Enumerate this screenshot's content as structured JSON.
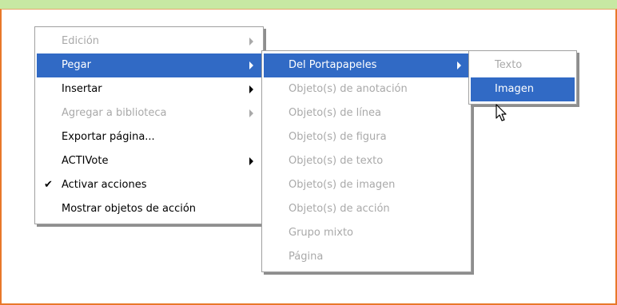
{
  "context_menu": {
    "items": [
      {
        "label": "Edición"
      },
      {
        "label": "Pegar"
      },
      {
        "label": "Insertar"
      },
      {
        "label": "Agregar a biblioteca"
      },
      {
        "label": "Exportar página..."
      },
      {
        "label": "ACTIVote"
      },
      {
        "label": "Activar acciones",
        "checkmark": "✔"
      },
      {
        "label": "Mostrar objetos de acción"
      }
    ]
  },
  "paste_submenu": {
    "items": [
      {
        "label": "Del Portapapeles"
      },
      {
        "label": "Objeto(s) de anotación"
      },
      {
        "label": "Objeto(s) de línea"
      },
      {
        "label": "Objeto(s) de figura"
      },
      {
        "label": "Objeto(s) de texto"
      },
      {
        "label": "Objeto(s) de imagen"
      },
      {
        "label": "Objeto(s) de acción"
      },
      {
        "label": "Grupo mixto"
      },
      {
        "label": "Página"
      }
    ]
  },
  "clipboard_submenu": {
    "items": [
      {
        "label": "Texto"
      },
      {
        "label": "Imagen"
      }
    ]
  },
  "colors": {
    "highlight": "#316ac5",
    "disabled_text": "#a9a9a9",
    "canvas_border": "#e8782a",
    "top_bar": "#c7e8a3"
  }
}
